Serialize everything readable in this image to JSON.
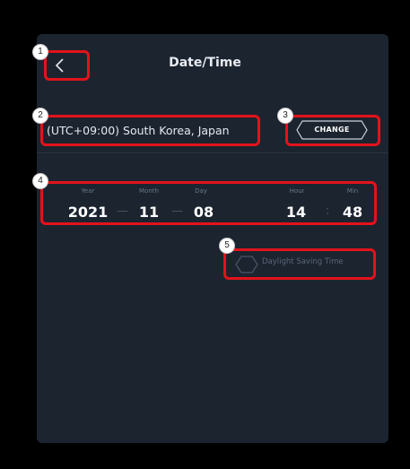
{
  "header": {
    "title": "Date/Time"
  },
  "timezone": {
    "value": "(UTC+09:00) South Korea, Japan",
    "change_label": "CHANGE"
  },
  "datetime": {
    "labels": {
      "year": "Year",
      "month": "Month",
      "day": "Day",
      "hour": "Hour",
      "min": "Min"
    },
    "values": {
      "year": "2021",
      "month": "11",
      "day": "08",
      "hour": "14",
      "min": "48"
    },
    "date_separator": "—",
    "time_separator": ":"
  },
  "dst": {
    "label": "Daylight Saving Time",
    "checked": false
  },
  "annotations": [
    "1",
    "2",
    "3",
    "4",
    "5"
  ],
  "colors": {
    "background": "#000000",
    "panel": "#1c2430",
    "highlight": "#e3131b",
    "text": "#ffffff",
    "muted": "#6a7585"
  }
}
